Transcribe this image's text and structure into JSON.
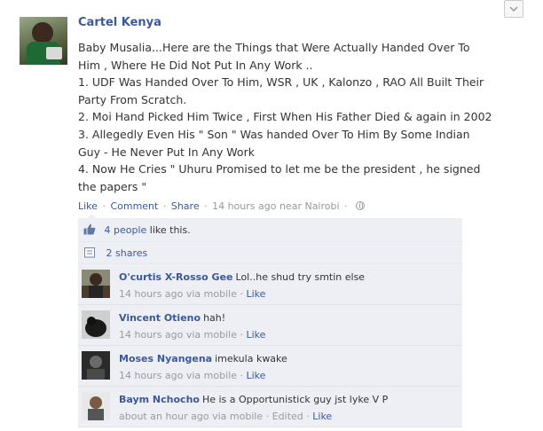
{
  "post": {
    "author": "Cartel Kenya",
    "lines": [
      "Baby Musalia...Here are the Things that Were Actually Handed Over To",
      "Him , Where He Did Not Put In Any Work ..",
      "1. UDF Was Handed Over To Him, WSR , UK , Kalonzo , RAO All Built Their",
      "Party From Scratch.",
      "2. Moi Hand Picked Him Twice , First When His Father Died & again in 2002",
      "3. Allegedly Even His \" Son \" Was handed Over To Him By Some Indian",
      "Guy - He Never Put In Any Work",
      "4. Now He Cries \" Uhuru Promised to let me be the president , he signed",
      "the papers \""
    ],
    "actions": {
      "like": "Like",
      "comment": "Comment",
      "share": "Share",
      "time": "14 hours ago near Nairobi",
      "separator": "·"
    }
  },
  "likes": {
    "count_link": "4 people",
    "suffix": " like this."
  },
  "shares": {
    "label": "2 shares"
  },
  "comments": [
    {
      "author": "O'curtis X-Rosso Gee",
      "text": "Lol..he shud try smtin else",
      "meta": "14 hours ago via mobile",
      "action": "Like"
    },
    {
      "author": "Vincent Otieno",
      "text": "hah!",
      "meta": "14 hours ago via mobile",
      "action": "Like"
    },
    {
      "author": "Moses Nyangena",
      "text": "imekula kwake",
      "meta": "14 hours ago via mobile",
      "action": "Like"
    },
    {
      "author": "Baym Nchocho",
      "text": "He is a Opportunistick guy jst lyke V P",
      "meta": "about an hour ago via mobile",
      "edited": "Edited",
      "action": "Like"
    }
  ],
  "icons": {
    "scroll": "chevron-down-icon",
    "like": "thumbs-up-icon",
    "share": "share-icon",
    "privacy": "globe-icon"
  },
  "colors": {
    "link": "#3b5998",
    "ufi_bg": "#edeff4",
    "meta": "#999999"
  }
}
